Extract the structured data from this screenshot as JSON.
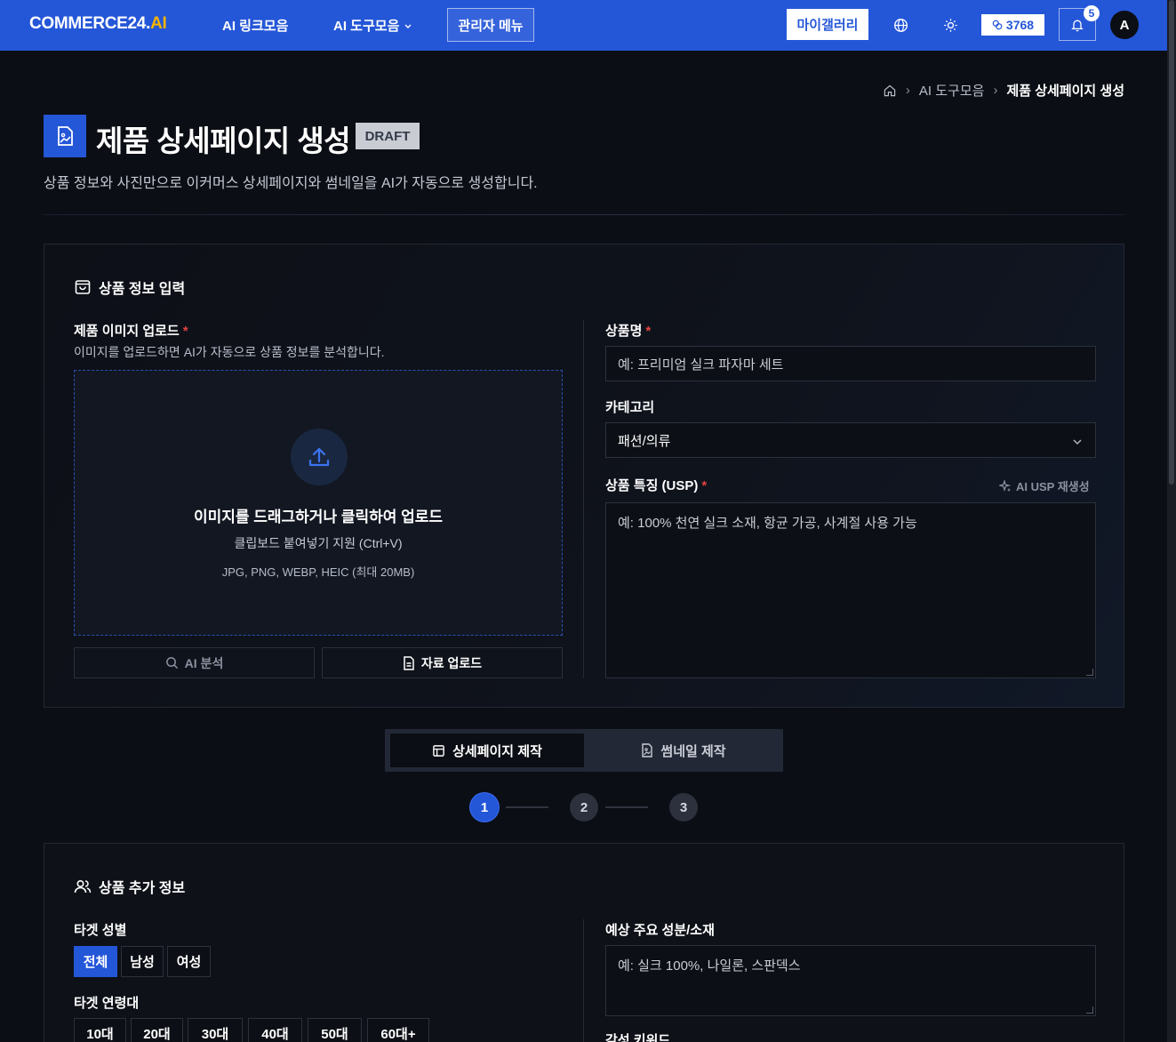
{
  "nav": {
    "logo_main": "COMMERCE24.",
    "logo_accent": "AI",
    "link_collection": "AI 링크모음",
    "tool_collection": "AI 도구모음",
    "admin_menu": "관리자 메뉴",
    "my_gallery": "마이갤러리",
    "credits": "3768",
    "notification_count": "5",
    "avatar_initial": "A",
    "brand_color": "#2456d8"
  },
  "breadcrumb": [
    "AI 도구모음",
    "제품 상세페이지 생성"
  ],
  "page": {
    "title": "제품 상세페이지 생성",
    "badge": "DRAFT",
    "subtitle": "상품 정보와 사진만으로 이커머스 상세페이지와 썸네일을 AI가 자동으로 생성합니다."
  },
  "product_info": {
    "section_title": "상품 정보 입력",
    "image_label": "제품 이미지 업로드",
    "image_help": "이미지를 업로드하면 AI가 자동으로 상품 정보를 분석합니다.",
    "dropzone_title": "이미지를 드래그하거나 클릭하여 업로드",
    "dropzone_clipboard": "클립보드 붙여넣기 지원 (Ctrl+V)",
    "dropzone_formats": "JPG, PNG, WEBP, HEIC (최대 20MB)",
    "ai_analyze": "AI 분석",
    "material_upload": "자료 업로드",
    "name_label": "상품명",
    "name_placeholder": "예: 프리미엄 실크 파자마 세트",
    "category_label": "카테고리",
    "category_value": "패션/의류",
    "usp_label": "상품 특징 (USP)",
    "usp_regen": "AI USP 재생성",
    "usp_placeholder": "예: 100% 천연 실크 소재, 항균 가공, 사계절 사용 가능"
  },
  "mode_tabs": [
    "상세페이지 제작",
    "썸네일 제작"
  ],
  "steps": [
    "1",
    "2",
    "3"
  ],
  "extra_info": {
    "section_title": "상품 추가 정보",
    "gender_label": "타겟 성별",
    "genders": [
      "전체",
      "남성",
      "여성"
    ],
    "age_label": "타겟 연령대",
    "ages": [
      "10대",
      "20대",
      "30대",
      "40대",
      "50대",
      "60대+"
    ],
    "material_label": "예상 주요 성분/소재",
    "material_placeholder": "예: 실크 100%, 나일론, 스판덱스",
    "keyword_label": "감성 키워드"
  }
}
